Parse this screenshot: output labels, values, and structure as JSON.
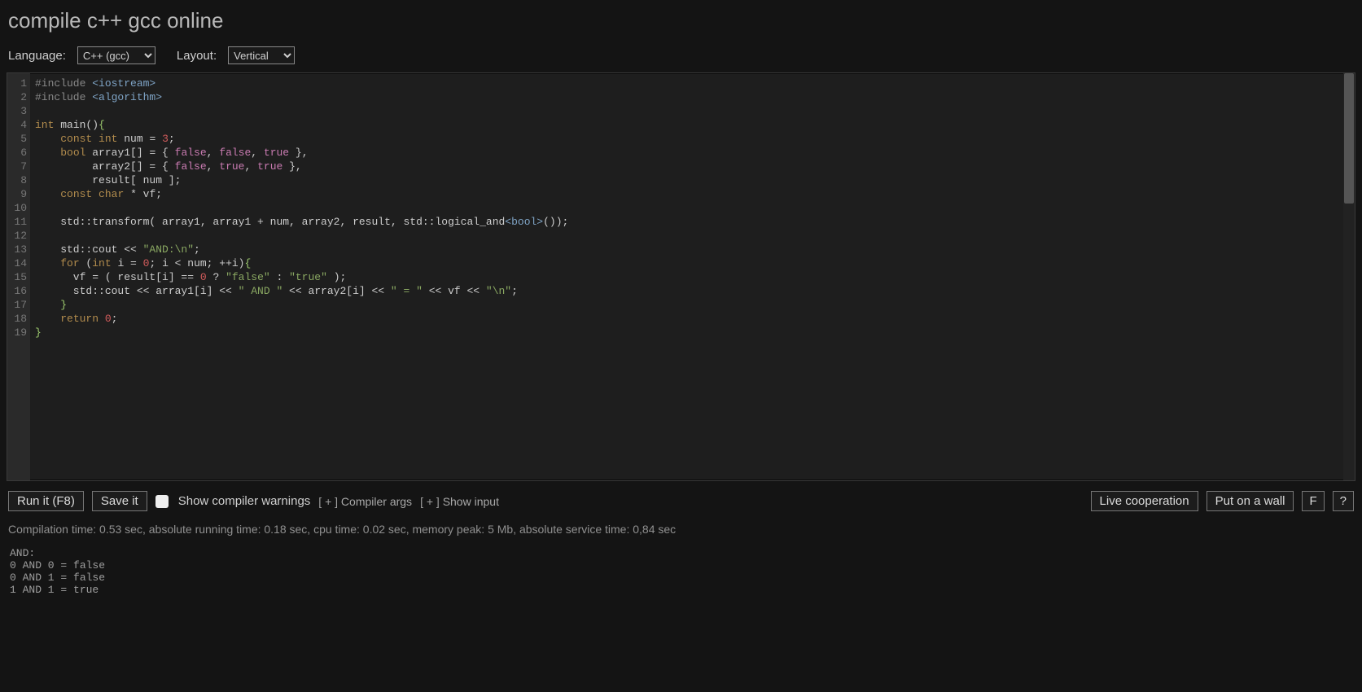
{
  "title": "compile c++ gcc online",
  "controls": {
    "language_label": "Language:",
    "language_value": "C++ (gcc)",
    "layout_label": "Layout:",
    "layout_value": "Vertical"
  },
  "editor": {
    "line_count": 19,
    "lines": [
      {
        "n": 1,
        "segs": [
          [
            "pp",
            "#include "
          ],
          [
            "type",
            "<iostream>"
          ]
        ]
      },
      {
        "n": 2,
        "segs": [
          [
            "pp",
            "#include "
          ],
          [
            "type",
            "<algorithm>"
          ]
        ]
      },
      {
        "n": 3,
        "segs": [
          [
            "plain",
            ""
          ]
        ]
      },
      {
        "n": 4,
        "segs": [
          [
            "kw",
            "int"
          ],
          [
            "plain",
            " main()"
          ],
          [
            "brace",
            "{"
          ]
        ]
      },
      {
        "n": 5,
        "segs": [
          [
            "plain",
            "    "
          ],
          [
            "kw",
            "const"
          ],
          [
            "plain",
            " "
          ],
          [
            "kw",
            "int"
          ],
          [
            "plain",
            " num = "
          ],
          [
            "num",
            "3"
          ],
          [
            "plain",
            ";"
          ]
        ]
      },
      {
        "n": 6,
        "segs": [
          [
            "plain",
            "    "
          ],
          [
            "kw",
            "bool"
          ],
          [
            "plain",
            " array1[] = { "
          ],
          [
            "bool",
            "false"
          ],
          [
            "plain",
            ", "
          ],
          [
            "bool",
            "false"
          ],
          [
            "plain",
            ", "
          ],
          [
            "bool",
            "true"
          ],
          [
            "plain",
            " },"
          ]
        ]
      },
      {
        "n": 7,
        "segs": [
          [
            "plain",
            "         array2[] = { "
          ],
          [
            "bool",
            "false"
          ],
          [
            "plain",
            ", "
          ],
          [
            "bool",
            "true"
          ],
          [
            "plain",
            ", "
          ],
          [
            "bool",
            "true"
          ],
          [
            "plain",
            " },"
          ]
        ]
      },
      {
        "n": 8,
        "segs": [
          [
            "plain",
            "         result[ num ];"
          ]
        ]
      },
      {
        "n": 9,
        "segs": [
          [
            "plain",
            "    "
          ],
          [
            "kw",
            "const"
          ],
          [
            "plain",
            " "
          ],
          [
            "kw",
            "char"
          ],
          [
            "plain",
            " * vf;"
          ]
        ]
      },
      {
        "n": 10,
        "segs": [
          [
            "plain",
            ""
          ]
        ]
      },
      {
        "n": 11,
        "segs": [
          [
            "plain",
            "    std::transform( array1, array1 + num, array2, result, std::logical_and"
          ],
          [
            "type",
            "<bool>"
          ],
          [
            "plain",
            "());"
          ]
        ]
      },
      {
        "n": 12,
        "segs": [
          [
            "plain",
            ""
          ]
        ]
      },
      {
        "n": 13,
        "segs": [
          [
            "plain",
            "    std::cout << "
          ],
          [
            "str",
            "\"AND:\\n\""
          ],
          [
            "plain",
            ";"
          ]
        ]
      },
      {
        "n": 14,
        "segs": [
          [
            "plain",
            "    "
          ],
          [
            "kw",
            "for"
          ],
          [
            "plain",
            " ("
          ],
          [
            "kw",
            "int"
          ],
          [
            "plain",
            " i = "
          ],
          [
            "num",
            "0"
          ],
          [
            "plain",
            "; i < num; ++i)"
          ],
          [
            "brace",
            "{"
          ]
        ]
      },
      {
        "n": 15,
        "segs": [
          [
            "plain",
            "      vf = ( result[i] == "
          ],
          [
            "num",
            "0"
          ],
          [
            "plain",
            " ? "
          ],
          [
            "str",
            "\"false\""
          ],
          [
            "plain",
            " : "
          ],
          [
            "str",
            "\"true\""
          ],
          [
            "plain",
            " );"
          ]
        ]
      },
      {
        "n": 16,
        "segs": [
          [
            "plain",
            "      std::cout << array1[i] << "
          ],
          [
            "str",
            "\" AND \""
          ],
          [
            "plain",
            " << array2[i] << "
          ],
          [
            "str",
            "\" = \""
          ],
          [
            "plain",
            " << vf << "
          ],
          [
            "str",
            "\"\\n\""
          ],
          [
            "plain",
            ";"
          ]
        ]
      },
      {
        "n": 17,
        "segs": [
          [
            "plain",
            "    "
          ],
          [
            "brace",
            "}"
          ]
        ]
      },
      {
        "n": 18,
        "segs": [
          [
            "plain",
            "    "
          ],
          [
            "kw",
            "return"
          ],
          [
            "plain",
            " "
          ],
          [
            "num",
            "0"
          ],
          [
            "plain",
            ";"
          ]
        ]
      },
      {
        "n": 19,
        "segs": [
          [
            "brace",
            "}"
          ]
        ]
      }
    ]
  },
  "toolbar": {
    "run_label": "Run it (F8)",
    "save_label": "Save it",
    "show_warnings_label": "Show compiler warnings",
    "compiler_args_prefix": "[ + ]",
    "compiler_args_label": "Compiler args",
    "show_input_prefix": "[ + ]",
    "show_input_label": "Show input",
    "live_label": "Live cooperation",
    "wall_label": "Put on a wall",
    "fullscreen_label": "F",
    "help_label": "?"
  },
  "stats_line": "Compilation time: 0.53 sec, absolute running time: 0.18 sec, cpu time: 0.02 sec, memory peak: 5 Mb, absolute service time: 0,84 sec",
  "output_text": "AND:\n0 AND 0 = false\n0 AND 1 = false\n1 AND 1 = true"
}
